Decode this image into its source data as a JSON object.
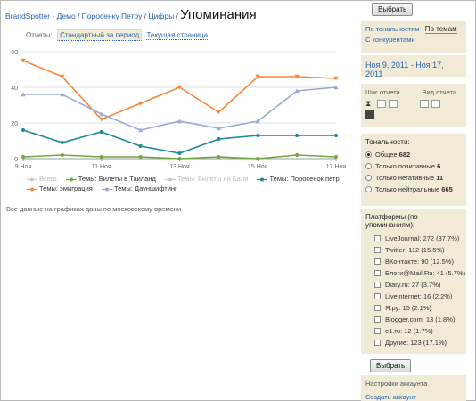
{
  "breadcrumb": {
    "items": [
      "BrandSpotter - Демо",
      "Поросенку Петру",
      "Цифры"
    ],
    "title": "Упоминания"
  },
  "top_button": "Выбрать",
  "bottom_button": "Выбрать",
  "tabs": {
    "label": "Отчеты:",
    "items": [
      "Стандартный за период",
      "Текущая страница"
    ]
  },
  "sentiment_mode": {
    "options": [
      "По тональностям",
      "По темам",
      "С конкурентами"
    ],
    "active": "По темам"
  },
  "period": "Ноя 9, 2011 - Ноя 17, 2011",
  "report_step": {
    "label": "Шаг отчета",
    "view_label": "Вид отчета"
  },
  "tonality": {
    "heading": "Тональности:",
    "items": [
      {
        "label": "Общее",
        "count": "682",
        "checked": true
      },
      {
        "label": "Только позитивные",
        "count": "6",
        "checked": false
      },
      {
        "label": "Только негативные",
        "count": "11",
        "checked": false
      },
      {
        "label": "Только нейтральные",
        "count": "665",
        "checked": false
      }
    ]
  },
  "platforms": {
    "heading": "Платформы (по упоминаниям):",
    "items": [
      "LiveJournal: 272 (37.7%)",
      "Twitter: 112 (15.5%)",
      "ВКонтакте: 90 (12.5%)",
      "Блоги@Mail.Ru: 41 (5.7%)",
      "Diary.ru: 27 (3.7%)",
      "Liveinternet: 16 (2.2%)",
      "Я.ру: 15 (2.1%)",
      "Blogger.com: 13 (1.8%)",
      "e1.ru: 12 (1.7%)",
      "Другие: 123 (17.1%)"
    ]
  },
  "account": {
    "settings": "Настройки аккаунта",
    "create": "Создать аккаунт"
  },
  "note": "Все данные на графиках даны по московскому времени",
  "colors": {
    "emigration": "#f4883a",
    "downshifting": "#9aaad6",
    "piglet": "#1a8a96",
    "thailand": "#6fa843",
    "bali": "#c9c9c9",
    "all": "#c9c9c9"
  },
  "chart_data": {
    "type": "line",
    "x": [
      "9 Ноя",
      "10 Ноя",
      "11 Ноя",
      "12 Ноя",
      "13 Ноя",
      "14 Ноя",
      "15 Ноя",
      "16 Ноя",
      "17 Ноя"
    ],
    "xticks": [
      "9 Ноя",
      "11 Ноя",
      "13 Ноя",
      "15 Ноя",
      "17 Ноя"
    ],
    "ylim": [
      0,
      60
    ],
    "yticks": [
      0,
      20,
      40,
      60
    ],
    "grid": true,
    "legend_position": "bottom",
    "series": [
      {
        "name": "Всего",
        "color_key": "all",
        "hidden": true,
        "values": []
      },
      {
        "name": "Темы: Билеты в Таиланд",
        "color_key": "thailand",
        "hidden": false,
        "values": [
          1,
          2,
          1,
          1,
          0,
          1,
          0,
          2,
          1
        ]
      },
      {
        "name": "Темы: Билеты на Бали",
        "color_key": "bali",
        "hidden": true,
        "values": []
      },
      {
        "name": "Темы: Поросенок петр",
        "color_key": "piglet",
        "hidden": false,
        "values": [
          16,
          9,
          15,
          7,
          3,
          11,
          13,
          13,
          13
        ]
      },
      {
        "name": "Темы: эмиграция",
        "color_key": "emigration",
        "hidden": false,
        "values": [
          55,
          46,
          22,
          31,
          40,
          26,
          46,
          46,
          45
        ]
      },
      {
        "name": "Темы: Дауншифтинг",
        "color_key": "downshifting",
        "hidden": false,
        "values": [
          36,
          36,
          25,
          16,
          21,
          17,
          21,
          38,
          40
        ]
      }
    ]
  }
}
